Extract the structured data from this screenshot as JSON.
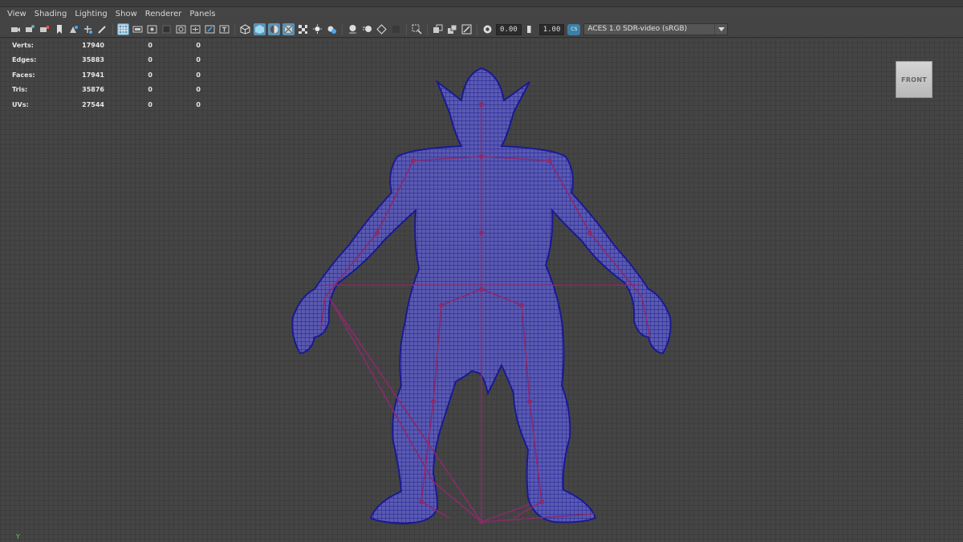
{
  "menu": {
    "items": [
      "View",
      "Shading",
      "Lighting",
      "Show",
      "Renderer",
      "Panels"
    ]
  },
  "toolbar": {
    "field_1": "0.00",
    "field_2": "1.00",
    "color_space_icon_text": "CS",
    "color_space": "ACES 1.0 SDR-video (sRGB)"
  },
  "hud": {
    "rows": [
      {
        "label": "Verts:",
        "value": "17940",
        "c1": "0",
        "c2": "0"
      },
      {
        "label": "Edges:",
        "value": "35883",
        "c1": "0",
        "c2": "0"
      },
      {
        "label": "Faces:",
        "value": "17941",
        "c1": "0",
        "c2": "0"
      },
      {
        "label": "Tris:",
        "value": "35876",
        "c1": "0",
        "c2": "0"
      },
      {
        "label": "UVs:",
        "value": "27544",
        "c1": "0",
        "c2": "0"
      }
    ]
  },
  "viewcube": {
    "label": "FRONT"
  },
  "axis": {
    "label": "Y"
  },
  "colors": {
    "mesh": "#2222aa",
    "skeleton": "#8a2a6a",
    "active_button": "#5b93b5",
    "grid": "#3d3d3d"
  }
}
